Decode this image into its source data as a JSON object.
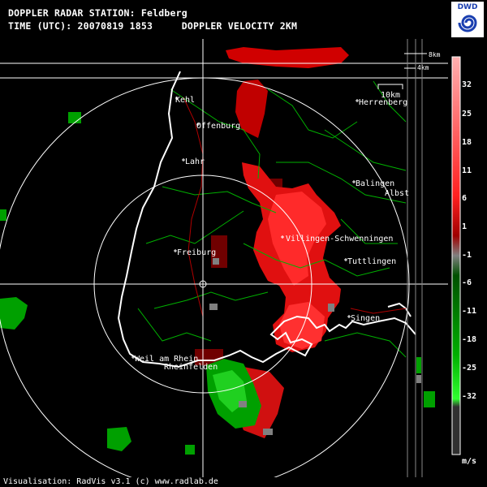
{
  "header": {
    "station_line": "DOPPLER RADAR STATION: Feldberg",
    "time_line": "TIME (UTC): 20070819 1853     DOPPLER VELOCITY 2KM"
  },
  "logo": {
    "text": "DWD"
  },
  "scale_bar": {
    "label": "10km"
  },
  "distance_markers": {
    "upper": "8km",
    "lower": "4km"
  },
  "cities": [
    {
      "name": "Kehl"
    },
    {
      "name": "Offenburg"
    },
    {
      "name": "Lahr"
    },
    {
      "name": "Freiburg"
    },
    {
      "name": "Weil am Rhein"
    },
    {
      "name": "Rheinfelden"
    },
    {
      "name": "Villingen-Schwenningen"
    },
    {
      "name": "Tuttlingen"
    },
    {
      "name": "Singen"
    },
    {
      "name": "Balingen"
    },
    {
      "name": "Albst"
    },
    {
      "name": "Herrenberg"
    }
  ],
  "legend": {
    "labels": [
      "32",
      "25",
      "18",
      "11",
      "6",
      "1",
      "-1",
      "-6",
      "-11",
      "-18",
      "-25",
      "-32"
    ],
    "unit": "m/s",
    "colors": {
      "positive_high": "#ff9090",
      "positive": "#ff1a1a",
      "positive_low": "#c00000",
      "near_zero": "#808080",
      "negative_low": "#006000",
      "negative": "#00b000",
      "negative_high": "#20ff20"
    }
  },
  "footer": {
    "text": "Visualisation: RadVis v3.1 (c) www.radlab.de"
  }
}
